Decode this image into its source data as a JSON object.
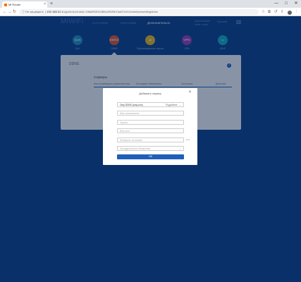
{
  "browser": {
    "tab_title": "Mi Router",
    "tab_close": "×",
    "new_tab": "+",
    "address_security": "Не защищено",
    "address_host": "192.168.31.1",
    "address_path": "/cgi-bin/luci/;stok=1f5a8f93f10480ca9f1f0b7aa57e241e/web/prosetting/ddns",
    "window_min": "—",
    "window_max": "□",
    "window_close": "✕"
  },
  "router": {
    "logo": "MiWiFi",
    "nav": [
      "Состояние",
      "Настройки",
      "Дополнительно"
    ],
    "info_line1": "Xiaomi Router",
    "info_line2": "Mode: route",
    "language": "Русский",
    "categories": [
      {
        "icon": "QoS",
        "label": "QoS",
        "color": "#1f8fb8"
      },
      {
        "icon": "DDNS",
        "label": "DDNS",
        "color": "#e2552b"
      },
      {
        "icon": "⇄",
        "label": "Перенаправление портов",
        "color": "#ecb71c"
      },
      {
        "icon": "VPN",
        "label": "VPN",
        "color": "#9b3bb3"
      },
      {
        "icon": "▭",
        "label": "UPnP",
        "color": "#13a9c0"
      }
    ]
  },
  "panel": {
    "title": "DDNS",
    "help": "?",
    "section_title": "Серверы",
    "columns": [
      "Имя провайдера и доменное имя",
      "Последнее обновление",
      "Состояние",
      "Действия"
    ]
  },
  "modal": {
    "title": "Добавить сервер",
    "close": "✕",
    "provider_value": "Oray DDNS (oray.com)",
    "provider_option": "Подробнее",
    "provider_arrow": "⌄",
    "username_placeholder": "Имя пользователя",
    "password_placeholder": "Пароль",
    "hostname_placeholder": "Имя узла",
    "interval_placeholder": "Проверять состояние",
    "interval_suffix": "мин",
    "force_update_placeholder": "Принудительное обновление",
    "force_update_arrow": "⌄",
    "ok_label": "ОК"
  }
}
